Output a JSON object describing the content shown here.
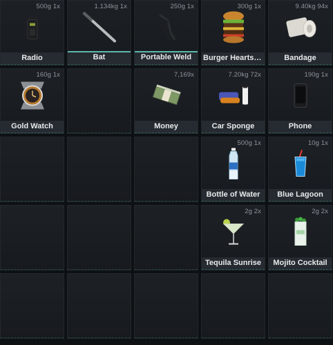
{
  "inventory": {
    "slots": [
      {
        "label": "Radio",
        "weight": "500g 1x",
        "icon": "radio-icon"
      },
      {
        "label": "Bat",
        "weight": "1.134kg 1x",
        "icon": "bat-icon"
      },
      {
        "label": "Portable Weld",
        "weight": "250g 1x",
        "icon": "welder-icon"
      },
      {
        "label": "Burger Heartstopper",
        "weight": "300g 1x",
        "icon": "burger-icon"
      },
      {
        "label": "Bandage",
        "weight": "9.40kg 94x",
        "icon": "bandage-icon"
      },
      {
        "label": "Gold Watch",
        "weight": "160g 1x",
        "icon": "watch-icon"
      },
      {
        "label": "",
        "weight": "",
        "icon": ""
      },
      {
        "label": "Money",
        "weight": "7,169x",
        "icon": "money-icon"
      },
      {
        "label": "Car Sponge",
        "weight": "7.20kg 72x",
        "icon": "car-sponge-icon"
      },
      {
        "label": "Phone",
        "weight": "190g 1x",
        "icon": "phone-icon"
      },
      {
        "label": "",
        "weight": "",
        "icon": ""
      },
      {
        "label": "",
        "weight": "",
        "icon": ""
      },
      {
        "label": "",
        "weight": "",
        "icon": ""
      },
      {
        "label": "Bottle of Water",
        "weight": "500g 1x",
        "icon": "water-bottle-icon"
      },
      {
        "label": "Blue Lagoon",
        "weight": "10g 1x",
        "icon": "blue-lagoon-icon"
      },
      {
        "label": "",
        "weight": "",
        "icon": ""
      },
      {
        "label": "",
        "weight": "",
        "icon": ""
      },
      {
        "label": "",
        "weight": "",
        "icon": ""
      },
      {
        "label": "Tequila Sunrise",
        "weight": "2g 2x",
        "icon": "tequila-sunrise-icon"
      },
      {
        "label": "Mojito Cocktail",
        "weight": "2g 2x",
        "icon": "mojito-icon"
      },
      {
        "label": "",
        "weight": "",
        "icon": ""
      },
      {
        "label": "",
        "weight": "",
        "icon": ""
      },
      {
        "label": "",
        "weight": "",
        "icon": ""
      },
      {
        "label": "",
        "weight": "",
        "icon": ""
      },
      {
        "label": "",
        "weight": "",
        "icon": ""
      }
    ]
  },
  "colors": {
    "background": "#0e1114",
    "slot": "#1b1f24",
    "accent": "#5fb8ac",
    "label_bg": "#282d33"
  }
}
